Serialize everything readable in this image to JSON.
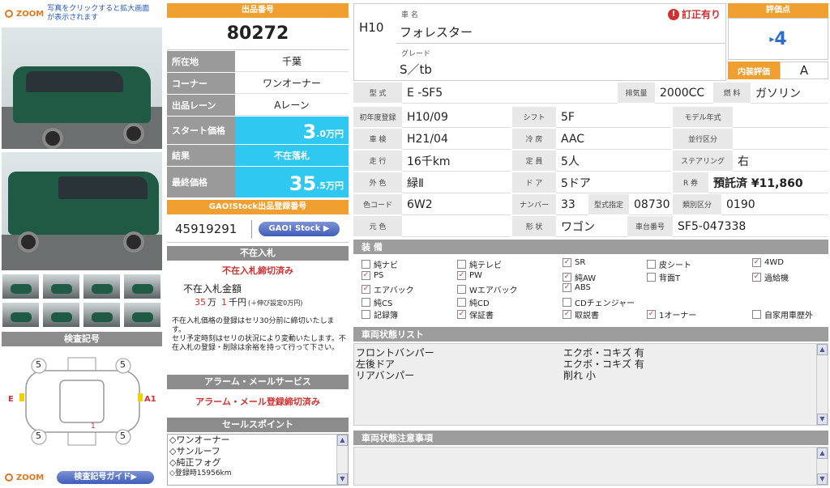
{
  "left": {
    "zoom_label": "ZOOM",
    "zoom_hint": "写真をクリックすると拡大画面が表示されます",
    "inspection_header": "検査記号",
    "diagram_marks": {
      "top_left": "5",
      "top_right": "5",
      "bottom_left": "5",
      "bottom_right": "5",
      "left": "E",
      "right": "A1",
      "center": "1"
    },
    "zoom_label_bottom": "ZOOM",
    "guide_button": "検査記号ガイド▶"
  },
  "lot": {
    "header": "出品番号",
    "number": "80272",
    "rows": [
      {
        "label": "所在地",
        "value": "千葉"
      },
      {
        "label": "コーナー",
        "value": "ワンオーナー"
      },
      {
        "label": "出品レーン",
        "value": "Aレーン"
      }
    ],
    "start_label": "スタート価格",
    "start_value": "3",
    "start_unit": ".0万円",
    "result_label": "結果",
    "result_value": "不在落札",
    "final_label": "最終価格",
    "final_value": "35",
    "final_unit": ".5万円",
    "stock_header": "GAO!Stock出品登録番号",
    "stock_number": "45919291",
    "stock_button": "GAO! Stock ▶",
    "absent_header": "不在入札",
    "absent_status": "不在入札締切済み",
    "absent_amount_label": "不在入札金額",
    "absent_amount_man": "35",
    "absent_amount_sen": "1",
    "absent_amount_text": "万  千円",
    "absent_amount_note": "(＋伸び設定0万円)",
    "absent_notes": [
      "不在入札価格の登録はセリ30分前に締切いたします。",
      "セリ予定時刻はセリの状況により変動いたします。不在入札の登録・削除は余裕を持って行って下さい。"
    ],
    "alarm_header": "アラーム・メールサービス",
    "alarm_status": "アラーム・メール登録締切済み",
    "sales_header": "セールスポイント",
    "sales_points": [
      "◇ワンオーナー",
      "◇サンルーフ",
      "◇純正フォグ",
      "◇登録時15956km"
    ]
  },
  "car": {
    "year": "H10",
    "name_label": "車 名",
    "name": "フォレスター",
    "corrected": "訂正有り",
    "grade_label": "グレード",
    "grade": "S／tb",
    "score_header": "評価点",
    "score": "4",
    "interior_label": "内装評価",
    "interior_value": "A",
    "model_label": "型 式",
    "model": "E -SF5",
    "displacement_label": "排気量",
    "displacement": "2000CC",
    "fuel_label": "燃 料",
    "fuel": "ガソリン",
    "specs": [
      [
        {
          "k": "初年度登録",
          "v": "H10/09"
        },
        {
          "k": "シフト",
          "v": "5F"
        },
        {
          "k": "モデル年式",
          "v": ""
        }
      ],
      [
        {
          "k": "車 検",
          "v": "H21/04"
        },
        {
          "k": "冷 房",
          "v": "AAC"
        },
        {
          "k": "並行区分",
          "v": ""
        }
      ],
      [
        {
          "k": "走 行",
          "v": "16千km"
        },
        {
          "k": "定 員",
          "v": "5人"
        },
        {
          "k": "ステアリング",
          "v": "右"
        }
      ],
      [
        {
          "k": "外 色",
          "v": "緑Ⅱ"
        },
        {
          "k": "ド ア",
          "v": "5ドア"
        },
        {
          "k": "R 券",
          "v": "預託済 ¥11,860"
        }
      ],
      [
        {
          "k": "色コード",
          "v": "6W2"
        },
        {
          "k": "ナンバー",
          "v": "33"
        },
        {
          "k": "類別区分",
          "v": "0190"
        }
      ],
      [
        {
          "k": "元 色",
          "v": ""
        },
        {
          "k": "形 状",
          "v": "ワゴン"
        },
        {
          "k": "車台番号",
          "v": "SF5-047338"
        }
      ]
    ],
    "type_designation_label": "型式指定",
    "type_designation": "08730"
  },
  "equipment": {
    "header": "装 備",
    "items": [
      {
        "label": "純ナビ",
        "checked": false
      },
      {
        "label": "純テレビ",
        "checked": false
      },
      {
        "label": "SR",
        "checked": true
      },
      {
        "label": "皮シート",
        "checked": false
      },
      {
        "label": "4WD",
        "checked": true
      },
      {
        "label": "PS",
        "checked": true
      },
      {
        "label": "PW",
        "checked": true
      },
      {
        "label": "純AW",
        "checked": true
      },
      {
        "label": "背面T",
        "checked": false
      },
      {
        "label": "過給機",
        "checked": true
      },
      {
        "label": "エアバック",
        "checked": true
      },
      {
        "label": "Wエアバック",
        "checked": false
      },
      {
        "label": "ABS",
        "checked": true
      },
      {
        "label": "",
        "checked": false
      },
      {
        "label": "",
        "checked": false
      },
      {
        "label": "純CS",
        "checked": false
      },
      {
        "label": "純CD",
        "checked": false
      },
      {
        "label": "CDチェンジャー",
        "checked": false
      },
      {
        "label": "",
        "checked": false
      },
      {
        "label": "",
        "checked": false
      },
      {
        "label": "記録簿",
        "checked": false
      },
      {
        "label": "保証書",
        "checked": true
      },
      {
        "label": "取説書",
        "checked": true
      },
      {
        "label": "1オーナー",
        "checked": true
      },
      {
        "label": "自家用車歴外",
        "checked": false
      }
    ]
  },
  "condition": {
    "header": "車両状態リスト",
    "rows": [
      {
        "part": "フロントバンパー",
        "desc": "エクボ・コキズ 有"
      },
      {
        "part": "左後ドア",
        "desc": "エクボ・コキズ 有"
      },
      {
        "part": "リアバンパー",
        "desc": "削れ 小"
      }
    ],
    "notes_header": "車両状態注意事項"
  },
  "colors": {
    "orange": "#f0a030",
    "cyan": "#2ec8f0",
    "red": "#d03030",
    "gray_header": "#9a9a9a"
  }
}
